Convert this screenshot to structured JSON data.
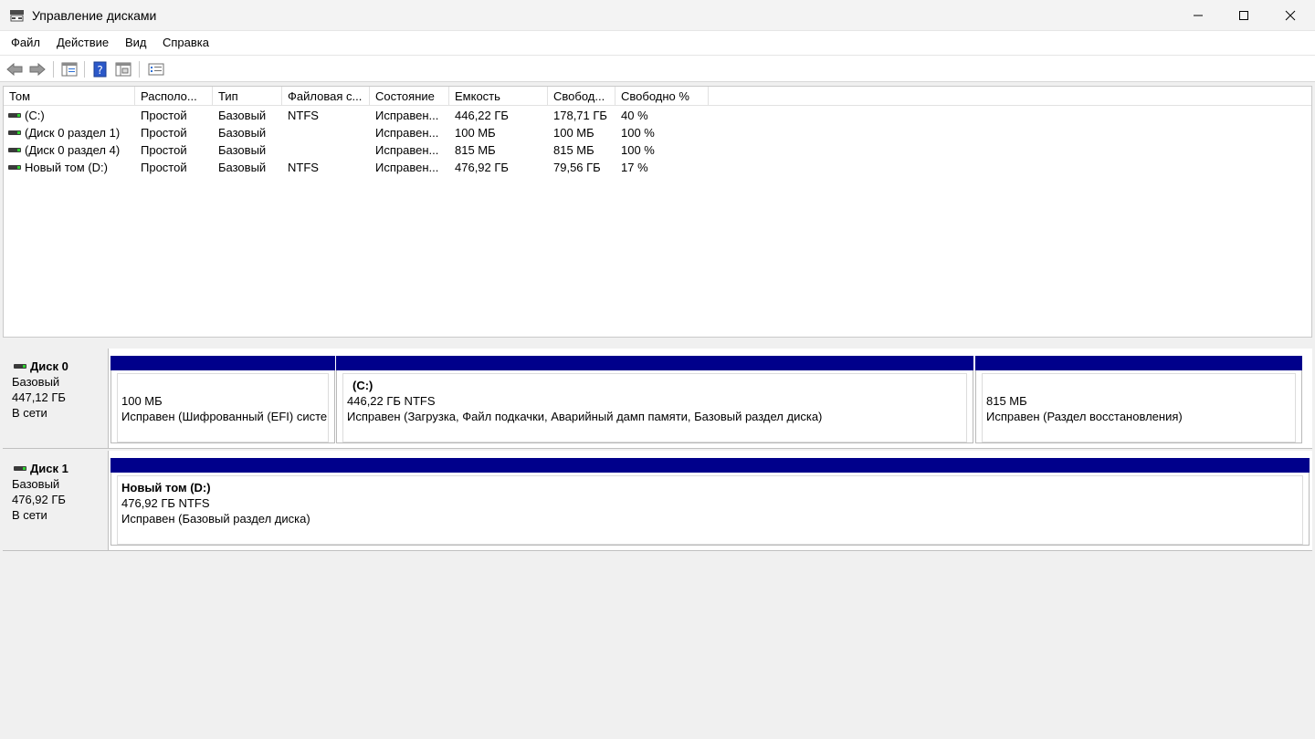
{
  "window": {
    "title": "Управление дисками"
  },
  "menu": [
    "Файл",
    "Действие",
    "Вид",
    "Справка"
  ],
  "toolbar": {
    "icons": [
      "back-arrow-icon",
      "forward-arrow-icon",
      "console-tree-icon",
      "help-icon",
      "properties-icon",
      "list-view-icon"
    ]
  },
  "columns": [
    "Том",
    "Располо...",
    "Тип",
    "Файловая с...",
    "Состояние",
    "Емкость",
    "Свобод...",
    "Свободно %"
  ],
  "volumes": [
    {
      "name": " (C:)",
      "layout": "Простой",
      "type": "Базовый",
      "fs": "NTFS",
      "status": "Исправен...",
      "capacity": "446,22 ГБ",
      "free": "178,71 ГБ",
      "free_pct": "40 %"
    },
    {
      "name": "(Диск 0 раздел 1)",
      "layout": "Простой",
      "type": "Базовый",
      "fs": "",
      "status": "Исправен...",
      "capacity": "100 МБ",
      "free": "100 МБ",
      "free_pct": "100 %"
    },
    {
      "name": "(Диск 0 раздел 4)",
      "layout": "Простой",
      "type": "Базовый",
      "fs": "",
      "status": "Исправен...",
      "capacity": "815 МБ",
      "free": "815 МБ",
      "free_pct": "100 %"
    },
    {
      "name": "Новый том (D:)",
      "layout": "Простой",
      "type": "Базовый",
      "fs": "NTFS",
      "status": "Исправен...",
      "capacity": "476,92 ГБ",
      "free": "79,56 ГБ",
      "free_pct": "17 %"
    }
  ],
  "disks": [
    {
      "name": "Диск 0",
      "type": "Базовый",
      "size": "447,12 ГБ",
      "state": "В сети",
      "partitions": [
        {
          "title": "",
          "size": "100 МБ",
          "status": "Исправен (Шифрованный (EFI) системный раздел)"
        },
        {
          "title": "(C:)",
          "size": "446,22 ГБ NTFS",
          "status": "Исправен (Загрузка, Файл подкачки, Аварийный дамп памяти, Базовый раздел диска)"
        },
        {
          "title": "",
          "size": "815 МБ",
          "status": "Исправен (Раздел восстановления)"
        }
      ]
    },
    {
      "name": "Диск 1",
      "type": "Базовый",
      "size": "476,92 ГБ",
      "state": "В сети",
      "partitions": [
        {
          "title": "Новый том  (D:)",
          "size": "476,92 ГБ NTFS",
          "status": "Исправен (Базовый раздел диска)"
        }
      ]
    }
  ],
  "colors": {
    "partition_bar": "#00008b",
    "background": "#f0f0f0"
  }
}
